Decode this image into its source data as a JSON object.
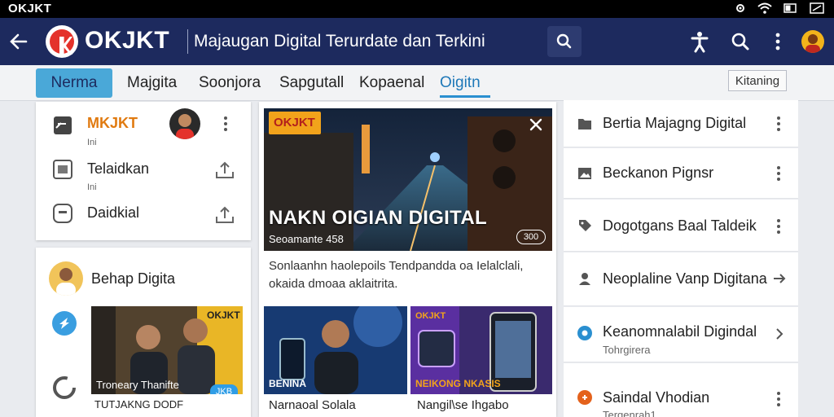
{
  "status_bar": {
    "carrier": "OKJKT"
  },
  "app_bar": {
    "brand": "OKJKT",
    "tagline": "Majaugan Digital Terurdate dan Terkini"
  },
  "tabs": [
    {
      "label": "Nerma",
      "state": "active"
    },
    {
      "label": "Majgita",
      "state": "normal"
    },
    {
      "label": "Soonjora",
      "state": "normal"
    },
    {
      "label": "Sapgutall",
      "state": "normal"
    },
    {
      "label": "Kopaenal",
      "state": "normal"
    },
    {
      "label": "Oigitn",
      "state": "underline"
    }
  ],
  "filter_button": "Kitaning",
  "left_top_card": {
    "items": [
      {
        "label": "MKJKT",
        "sub": "Ini"
      },
      {
        "label": "Telaidkan",
        "sub": "Ini"
      },
      {
        "label": "Daidkial",
        "sub": ""
      }
    ]
  },
  "left_bottom_card": {
    "title": "Behap Digita",
    "thumb_badge": "OKJKT",
    "thumb_caption": "Troneary Thanifte",
    "play_badge": "JKB",
    "caption": "TUTJAKNG DODF"
  },
  "feature": {
    "badge": "OKJKT",
    "title": "NAKN OIGIAN DIGITAL",
    "meta": "Seoamante  458",
    "duration": "300",
    "description": "Sonlaanhn haolepoils Tendpandda oa Ielalclali, okaida dmoaa aklaitrita."
  },
  "grid_items": [
    {
      "overlay": "BENINA",
      "caption": "Narnaoal Solala"
    },
    {
      "overlay_top": "OKJKT",
      "overlay": "NEIKONG NKASIS",
      "caption": "Nangil\\se Ihgabo"
    }
  ],
  "right_list": [
    {
      "label": "Bertia Majagng Digital",
      "sub": "",
      "icon": "folder-icon",
      "action": "more"
    },
    {
      "label": "Beckanon Pignsr",
      "sub": "",
      "icon": "image-icon",
      "action": "more"
    },
    {
      "label": "Dogotgans Baal Taldeik",
      "sub": "",
      "icon": "tag-icon",
      "action": "more"
    },
    {
      "label": "Neoplaline Vanp Digitana",
      "sub": "",
      "icon": "user-icon",
      "action": "arrow"
    },
    {
      "label": "Keanomnalabil Digindal",
      "sub": "Tohrgirera",
      "icon": "blue-dot-icon",
      "action": "chevron"
    },
    {
      "label": "Saindal Vhodian",
      "sub": "Tergenrah1",
      "icon": "orange-dot-icon",
      "action": "more"
    }
  ],
  "colors": {
    "app_bar": "#1d2a5e",
    "tab_active": "#4aa8d8",
    "accent_orange": "#f2a31b",
    "brand_red": "#e4322b"
  }
}
